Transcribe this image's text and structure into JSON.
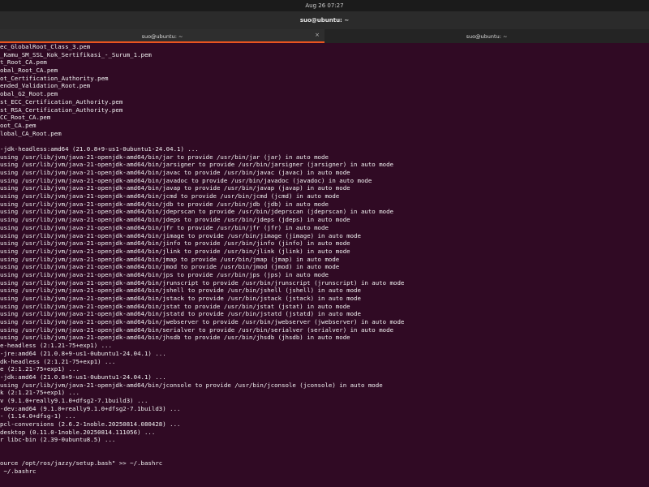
{
  "topbar": {
    "datetime": "Aug 26  07:27"
  },
  "window": {
    "title": "suo@ubuntu: ~"
  },
  "tabs": [
    {
      "label": "suo@ubuntu: ~",
      "close": "×"
    },
    {
      "label": "suo@ubuntu: ~",
      "close": ""
    }
  ],
  "terminal": {
    "lines": [
      "ec_GlobalRoot_Class_3.pem",
      "_Kamu_SM_SSL_Kok_Sertifikasi_-_Surum_1.pem",
      "t_Root_CA.pem",
      "obal_Root_CA.pem",
      "ot_Certification_Authority.pem",
      "ended_Validation_Root.pem",
      "obal_G2_Root.pem",
      "st_ECC_Certification_Authority.pem",
      "st_RSA_Certification_Authority.pem",
      "CC_Root_CA.pem",
      "oot_CA.pem",
      "lobal_CA_Root.pem",
      "",
      "-jdk-headless:amd64 (21.0.8+9-us1-0ubuntu1-24.04.1) ...",
      "using /usr/lib/jvm/java-21-openjdk-amd64/bin/jar to provide /usr/bin/jar (jar) in auto mode",
      "using /usr/lib/jvm/java-21-openjdk-amd64/bin/jarsigner to provide /usr/bin/jarsigner (jarsigner) in auto mode",
      "using /usr/lib/jvm/java-21-openjdk-amd64/bin/javac to provide /usr/bin/javac (javac) in auto mode",
      "using /usr/lib/jvm/java-21-openjdk-amd64/bin/javadoc to provide /usr/bin/javadoc (javadoc) in auto mode",
      "using /usr/lib/jvm/java-21-openjdk-amd64/bin/javap to provide /usr/bin/javap (javap) in auto mode",
      "using /usr/lib/jvm/java-21-openjdk-amd64/bin/jcmd to provide /usr/bin/jcmd (jcmd) in auto mode",
      "using /usr/lib/jvm/java-21-openjdk-amd64/bin/jdb to provide /usr/bin/jdb (jdb) in auto mode",
      "using /usr/lib/jvm/java-21-openjdk-amd64/bin/jdeprscan to provide /usr/bin/jdeprscan (jdeprscan) in auto mode",
      "using /usr/lib/jvm/java-21-openjdk-amd64/bin/jdeps to provide /usr/bin/jdeps (jdeps) in auto mode",
      "using /usr/lib/jvm/java-21-openjdk-amd64/bin/jfr to provide /usr/bin/jfr (jfr) in auto mode",
      "using /usr/lib/jvm/java-21-openjdk-amd64/bin/jimage to provide /usr/bin/jimage (jimage) in auto mode",
      "using /usr/lib/jvm/java-21-openjdk-amd64/bin/jinfo to provide /usr/bin/jinfo (jinfo) in auto mode",
      "using /usr/lib/jvm/java-21-openjdk-amd64/bin/jlink to provide /usr/bin/jlink (jlink) in auto mode",
      "using /usr/lib/jvm/java-21-openjdk-amd64/bin/jmap to provide /usr/bin/jmap (jmap) in auto mode",
      "using /usr/lib/jvm/java-21-openjdk-amd64/bin/jmod to provide /usr/bin/jmod (jmod) in auto mode",
      "using /usr/lib/jvm/java-21-openjdk-amd64/bin/jps to provide /usr/bin/jps (jps) in auto mode",
      "using /usr/lib/jvm/java-21-openjdk-amd64/bin/jrunscript to provide /usr/bin/jrunscript (jrunscript) in auto mode",
      "using /usr/lib/jvm/java-21-openjdk-amd64/bin/jshell to provide /usr/bin/jshell (jshell) in auto mode",
      "using /usr/lib/jvm/java-21-openjdk-amd64/bin/jstack to provide /usr/bin/jstack (jstack) in auto mode",
      "using /usr/lib/jvm/java-21-openjdk-amd64/bin/jstat to provide /usr/bin/jstat (jstat) in auto mode",
      "using /usr/lib/jvm/java-21-openjdk-amd64/bin/jstatd to provide /usr/bin/jstatd (jstatd) in auto mode",
      "using /usr/lib/jvm/java-21-openjdk-amd64/bin/jwebserver to provide /usr/bin/jwebserver (jwebserver) in auto mode",
      "using /usr/lib/jvm/java-21-openjdk-amd64/bin/serialver to provide /usr/bin/serialver (serialver) in auto mode",
      "using /usr/lib/jvm/java-21-openjdk-amd64/bin/jhsdb to provide /usr/bin/jhsdb (jhsdb) in auto mode",
      "e-headless (2:1.21-75+exp1) ...",
      "-jre:amd64 (21.0.8+9-us1-0ubuntu1-24.04.1) ...",
      "dk-headless (2:1.21-75+exp1) ...",
      "e (2:1.21-75+exp1) ...",
      "-jdk:amd64 (21.0.8+9-us1-0ubuntu1-24.04.1) ...",
      "using /usr/lib/jvm/java-21-openjdk-amd64/bin/jconsole to provide /usr/bin/jconsole (jconsole) in auto mode",
      "k (2:1.21-75+exp1) ...",
      "v (9.1.0+really9.1.0+dfsg2-7.1build3) ...",
      "-dev:amd64 (9.1.0+really9.1.0+dfsg2-7.1build3) ...",
      "- (1.14.0+dfsg-1) ...",
      "pcl-conversions (2.6.2-1noble.20250814.080428) ...",
      "desktop (0.11.0-1noble.20250814.111056) ...",
      "r libc-bin (2.39-0ubuntu8.5) ...",
      "",
      "",
      "ource /opt/ros/jazzy/setup.bash\" >> ~/.bashrc",
      " ~/.bashrc"
    ]
  }
}
